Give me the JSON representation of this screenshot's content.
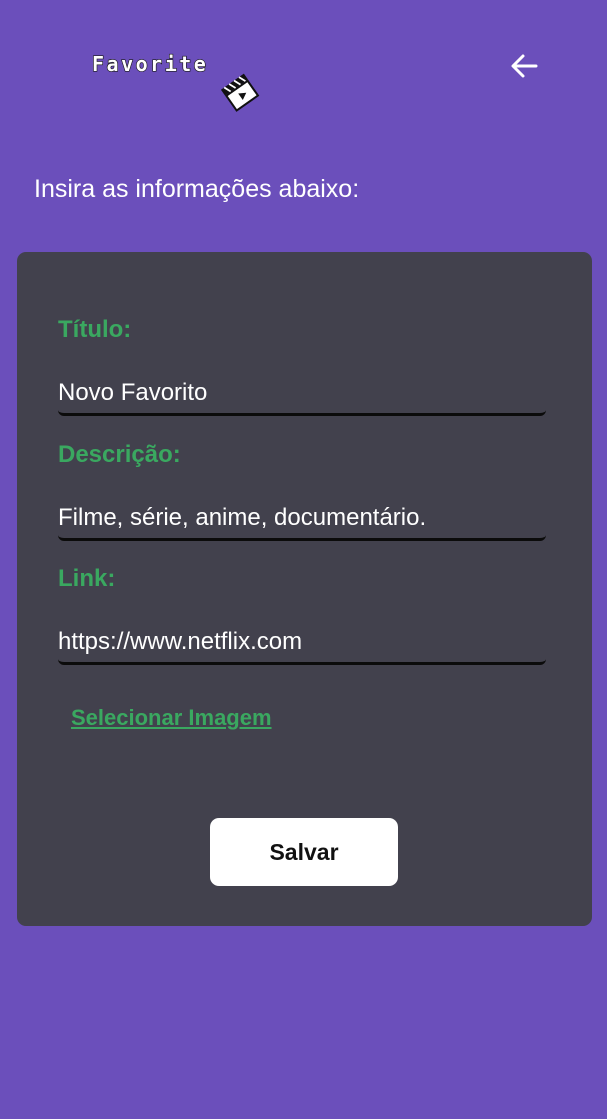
{
  "header": {
    "logo_text": "Favorite",
    "logo_icon": "clapperboard-icon",
    "back_icon": "arrow-left-icon"
  },
  "instruction": "Insira as informações abaixo:",
  "form": {
    "title": {
      "label": "Título:",
      "value": "Novo Favorito"
    },
    "description": {
      "label": "Descrição:",
      "value": "Filme, série, anime, documentário."
    },
    "link": {
      "label": "Link:",
      "value": "https://www.netflix.com"
    },
    "select_image_label": "Selecionar Imagem",
    "save_label": "Salvar"
  },
  "colors": {
    "background": "#6b4fbb",
    "card": "#42414d",
    "accent_green": "#3aa860",
    "text_white": "#ffffff"
  }
}
